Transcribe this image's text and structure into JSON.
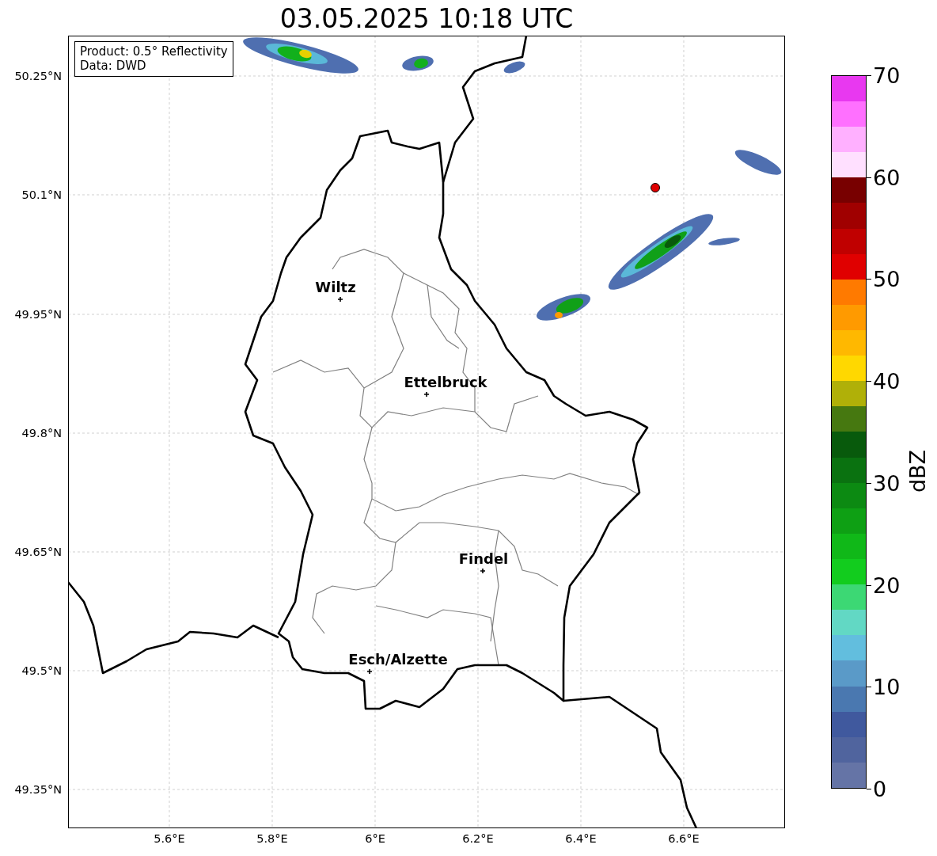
{
  "title": "03.05.2025 10:18 UTC",
  "info_box": [
    "Product: 0.5° Reflectivity",
    "Data: DWD"
  ],
  "map": {
    "lat_ticks": [
      "50.25°N",
      "50.1°N",
      "49.95°N",
      "49.8°N",
      "49.65°N",
      "49.5°N",
      "49.35°N"
    ],
    "lon_ticks": [
      "5.6°E",
      "5.8°E",
      "6°E",
      "6.2°E",
      "6.4°E",
      "6.6°E"
    ],
    "cities": [
      {
        "name": "Wiltz"
      },
      {
        "name": "Ettelbruck"
      },
      {
        "name": "Findel"
      },
      {
        "name": "Esch/Alzette"
      }
    ]
  },
  "colorbar": {
    "label": "dBZ",
    "ticks": [
      "70",
      "60",
      "50",
      "40",
      "30",
      "20",
      "10",
      "0"
    ]
  }
}
